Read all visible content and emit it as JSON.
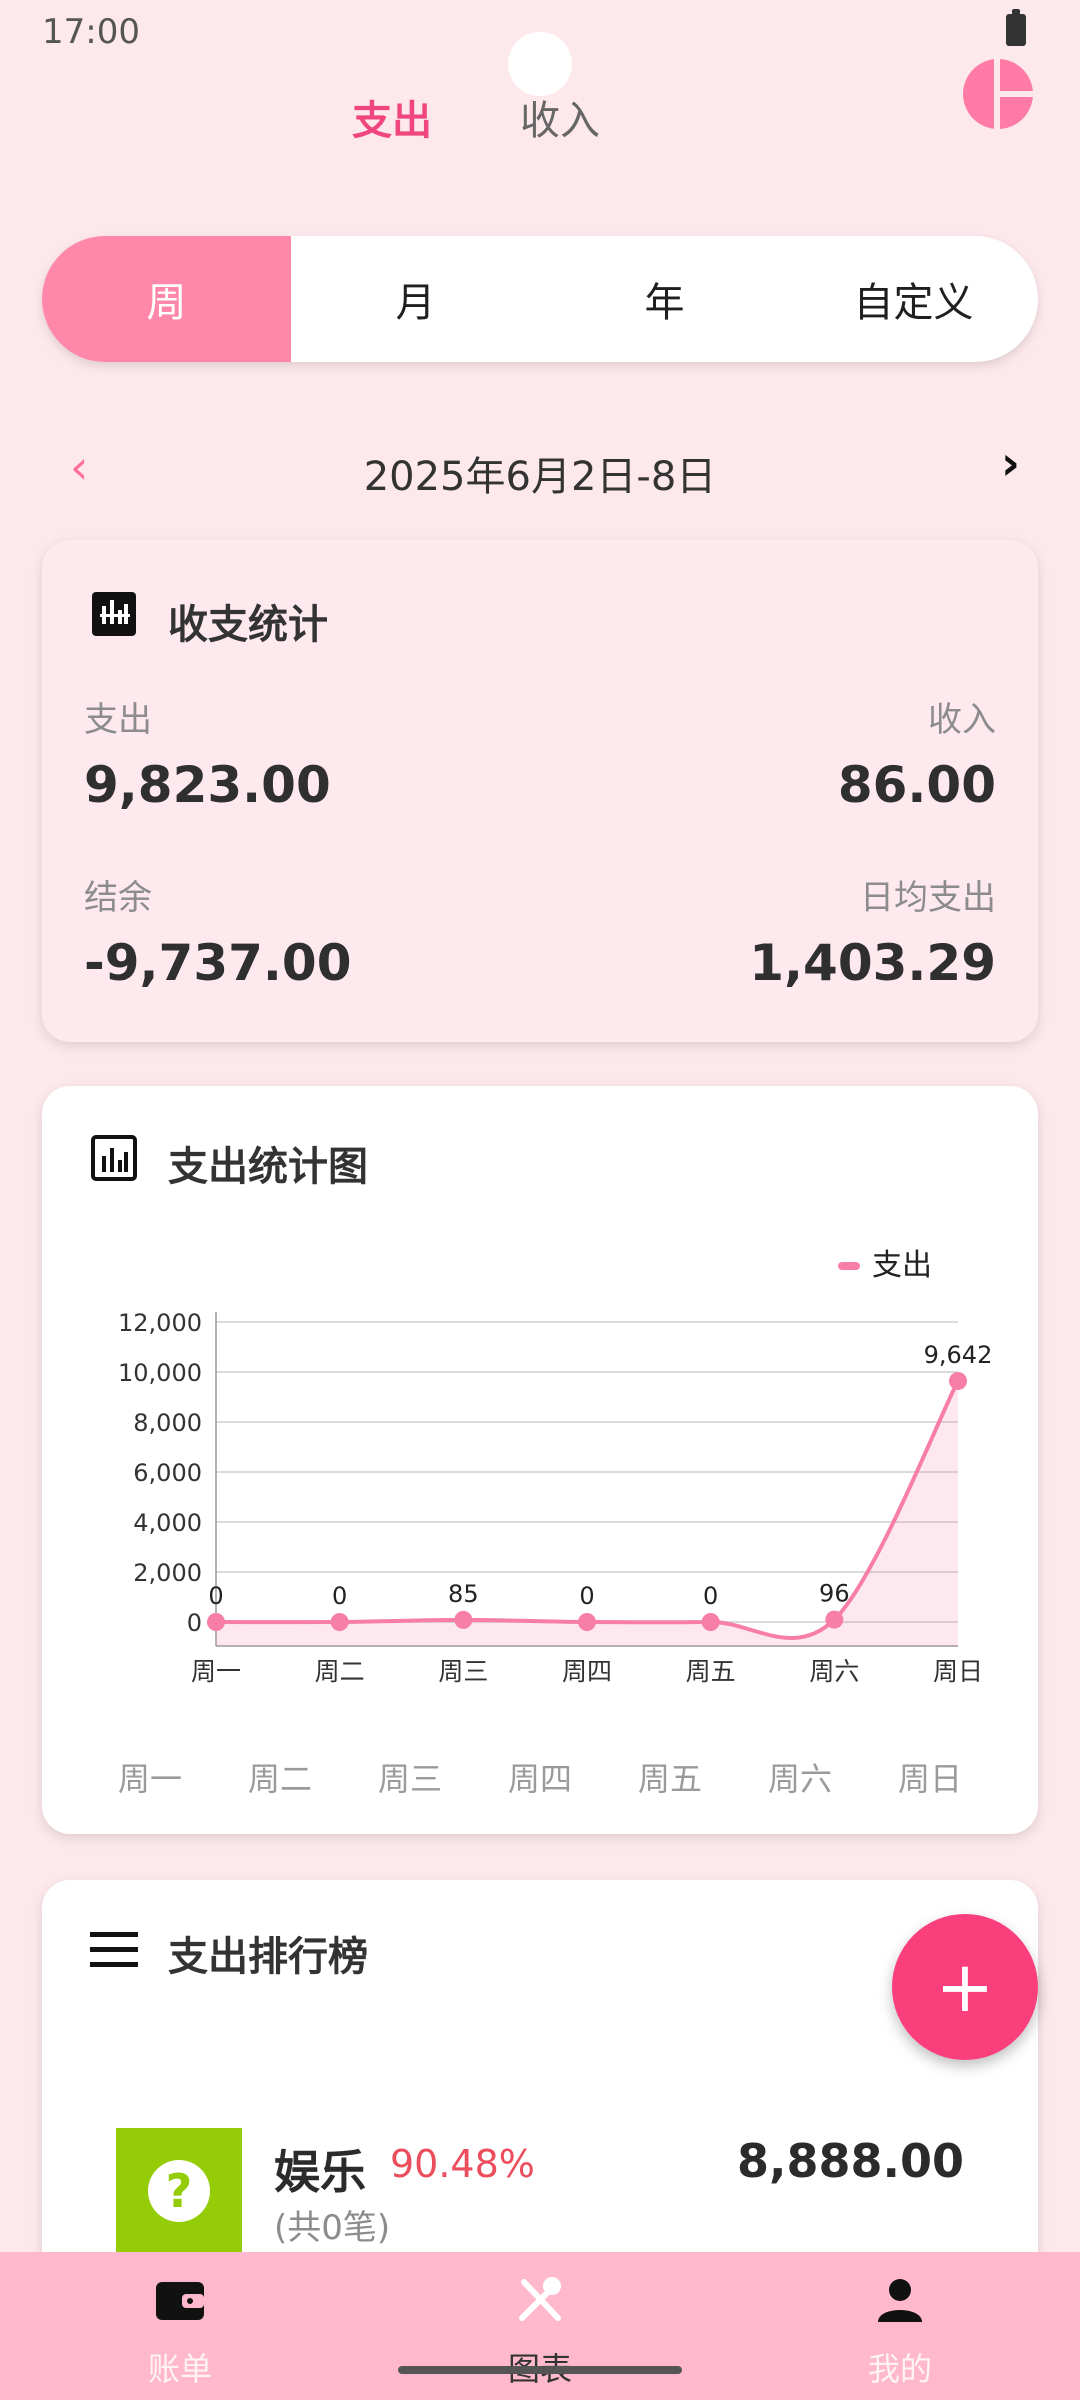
{
  "status": {
    "time": "17:00"
  },
  "top_tabs": {
    "expense": "支出",
    "income": "收入"
  },
  "period_tabs": [
    "周",
    "月",
    "年",
    "自定义"
  ],
  "date_nav": {
    "prev": "‹",
    "next": "›",
    "range": "2025年6月2日-8日"
  },
  "summary": {
    "title": "收支统计",
    "expense_label": "支出",
    "expense_value": "9,823.00",
    "income_label": "收入",
    "income_value": "86.00",
    "balance_label": "结余",
    "balance_value": "-9,737.00",
    "daily_label": "日均支出",
    "daily_value": "1,403.29"
  },
  "chart_card": {
    "title": "支出统计图",
    "bottom_labels": [
      "周一",
      "周二",
      "周三",
      "周四",
      "周五",
      "周六",
      "周日"
    ]
  },
  "chart_data": {
    "type": "line",
    "categories": [
      "周一",
      "周二",
      "周三",
      "周四",
      "周五",
      "周六",
      "周日"
    ],
    "series": [
      {
        "name": "支出",
        "values": [
          0,
          0,
          85,
          0,
          0,
          96,
          9642
        ]
      }
    ],
    "data_labels": [
      "0",
      "0",
      "85",
      "0",
      "0",
      "96",
      "9,642"
    ],
    "ylim": [
      0,
      12000
    ],
    "yticks": [
      "0",
      "2,000",
      "4,000",
      "6,000",
      "8,000",
      "10,000",
      "12,000"
    ],
    "legend": "top-right",
    "grid": true,
    "color": "#f77fa7"
  },
  "ranking": {
    "title": "支出排行榜",
    "items": [
      {
        "name": "娱乐",
        "percent": "90.48%",
        "count": "(共0笔)",
        "amount": "8,888.00",
        "icon": "question-icon",
        "color": "#95cc08"
      }
    ]
  },
  "fab": {
    "label": "+"
  },
  "nav": {
    "bill": "账单",
    "chart": "图表",
    "mine": "我的"
  },
  "colors": {
    "accent": "#f0467f",
    "pink_light": "#ff87aa",
    "fab": "#fb3f7c",
    "nav_bg": "#ffb8cc"
  }
}
